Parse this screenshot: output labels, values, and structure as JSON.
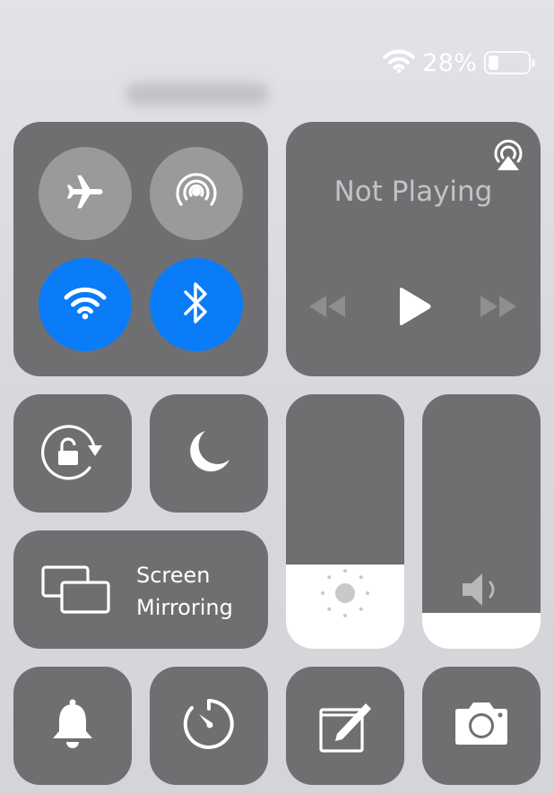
{
  "status_bar": {
    "battery_percent": "28%",
    "battery_level": 0.28
  },
  "connectivity": {
    "airplane_mode": {
      "active": false,
      "icon": "airplane-icon"
    },
    "airdrop": {
      "active": false,
      "icon": "airdrop-icon"
    },
    "wifi": {
      "active": true,
      "icon": "wifi-icon"
    },
    "bluetooth": {
      "active": true,
      "icon": "bluetooth-icon"
    }
  },
  "now_playing": {
    "title": "Not Playing",
    "controls": [
      "rewind-icon",
      "play-icon",
      "fast-forward-icon"
    ],
    "airplay_icon": "airplay-audio-icon"
  },
  "toggles": {
    "rotation_lock": {
      "icon": "rotation-lock-icon"
    },
    "do_not_disturb": {
      "icon": "moon-icon"
    }
  },
  "screen_mirroring": {
    "line1": "Screen",
    "line2": "Mirroring",
    "icon": "screen-mirroring-icon"
  },
  "sliders": {
    "brightness": {
      "level": 0.33,
      "icon": "sun-icon"
    },
    "volume": {
      "level": 0.14,
      "icon": "speaker-icon"
    }
  },
  "bottom_row": [
    "bell-icon",
    "timer-icon",
    "notes-icon",
    "camera-icon"
  ],
  "colors": {
    "tile": "#6f6f72",
    "active_blue": "#0a7cf8",
    "inactive_circle": "#9a9a9d",
    "background": "#d9d9de"
  }
}
